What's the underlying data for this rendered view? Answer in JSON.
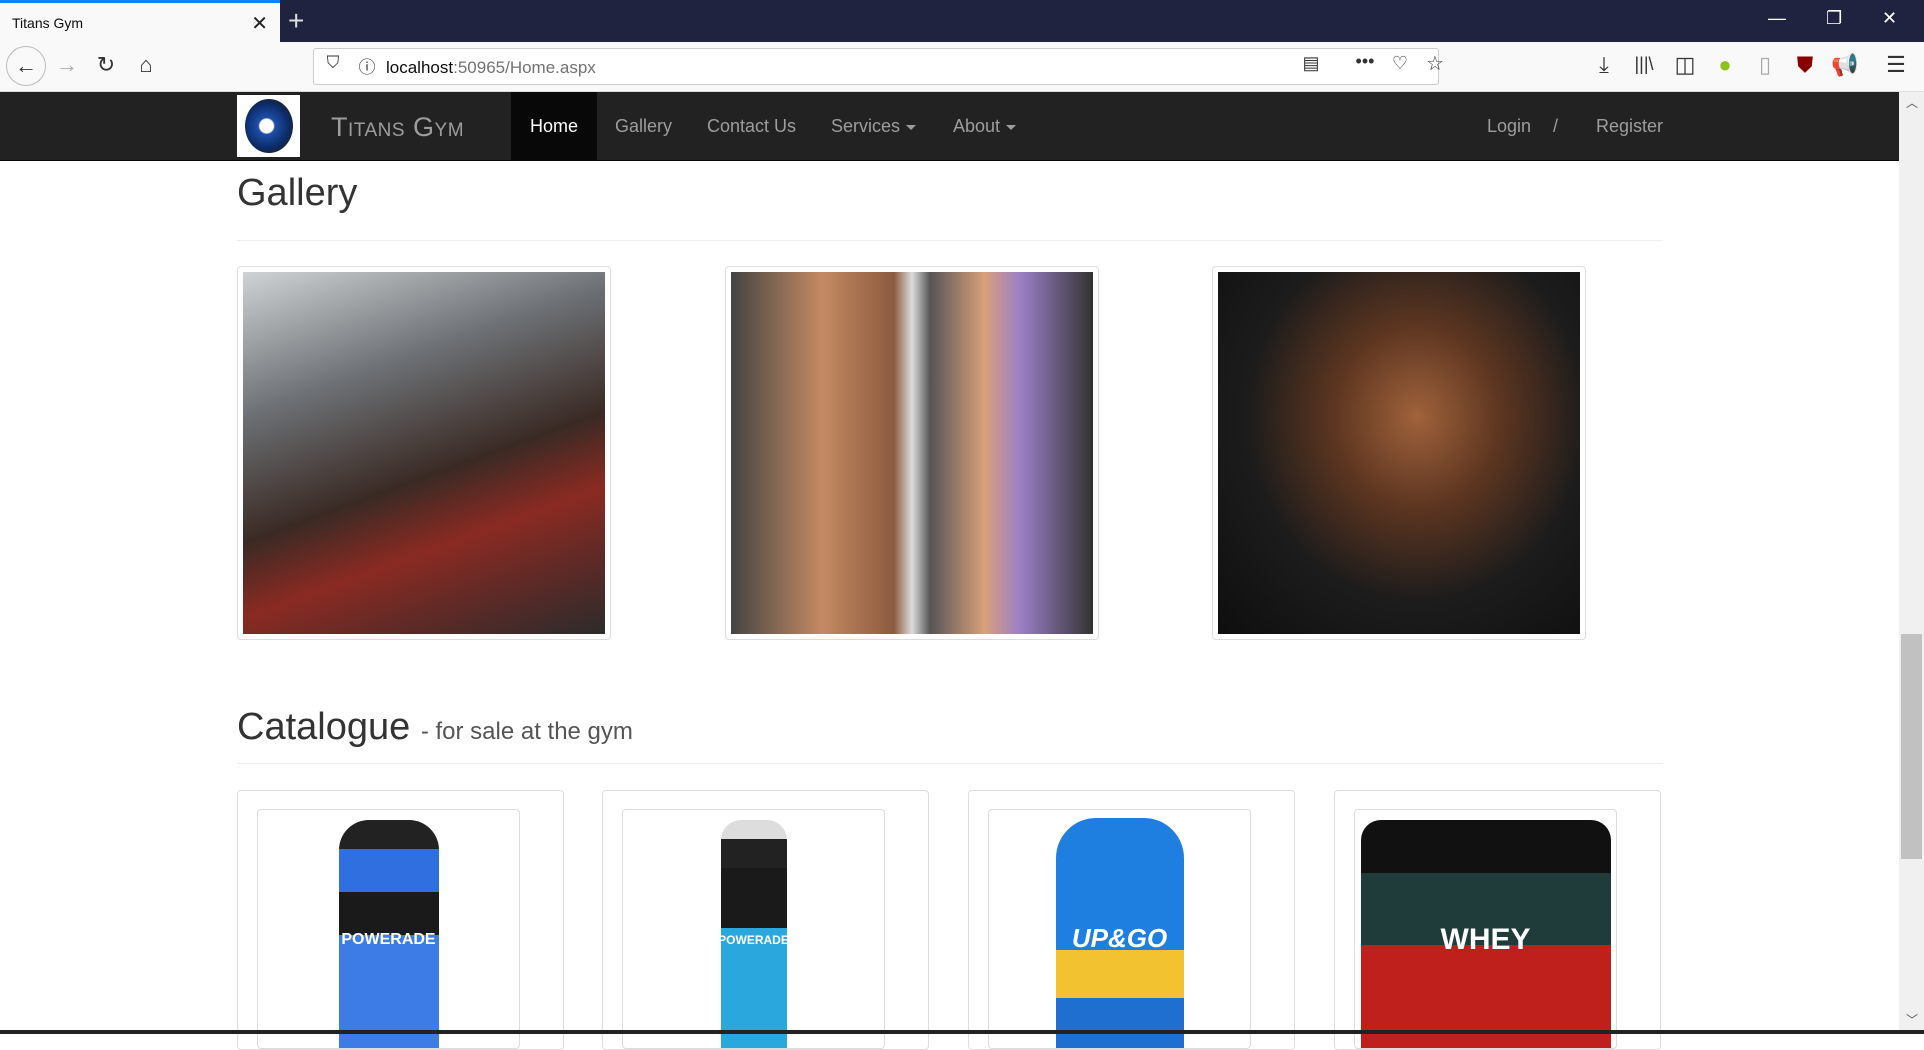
{
  "browser": {
    "tab_title": "Titans Gym",
    "url_host": "localhost",
    "url_rest": ":50965/Home.aspx"
  },
  "navbar": {
    "brand": "Titans Gym",
    "items": [
      {
        "label": "Home",
        "active": true
      },
      {
        "label": "Gallery"
      },
      {
        "label": "Contact Us"
      },
      {
        "label": "Services",
        "dropdown": true
      },
      {
        "label": "About",
        "dropdown": true
      }
    ],
    "login": "Login",
    "separator": "/",
    "register": "Register"
  },
  "gallery": {
    "title": "Gallery",
    "images": [
      "barbell-row-photo",
      "lat-pulldown-photo",
      "dumbbell-curl-photo"
    ]
  },
  "catalogue": {
    "title": "Catalogue",
    "subtitle": "- for sale at the gym",
    "products": [
      {
        "image": "powerade-bottle",
        "label": "POWERADE",
        "color": "#2f6fe0"
      },
      {
        "image": "powerade-sports-bottle",
        "label": "POWERADE",
        "color": "#2aa8dd"
      },
      {
        "image": "up-and-go-bottle",
        "label": "UP&GO",
        "color": "#1e7fe0"
      },
      {
        "image": "whey-protein-tubs",
        "label": "WHEY",
        "color": "#c0201b"
      }
    ]
  }
}
